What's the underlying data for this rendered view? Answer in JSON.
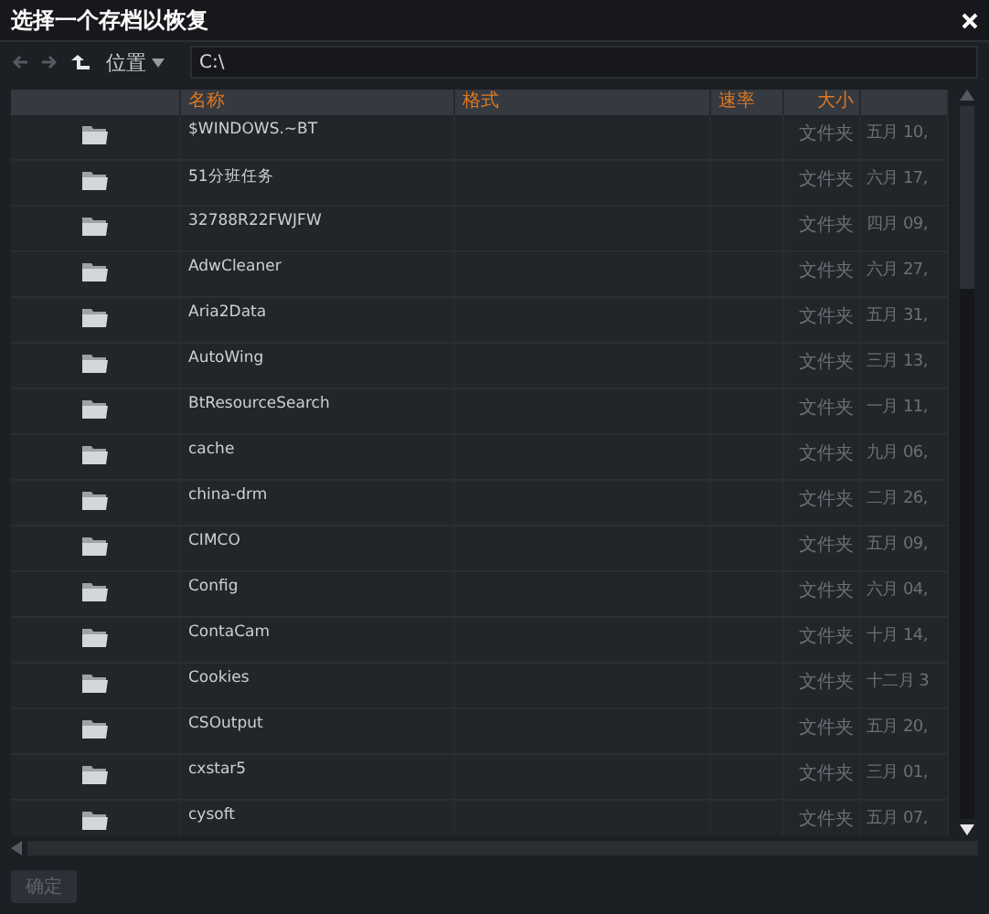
{
  "window": {
    "title": "选择一个存档以恢复"
  },
  "toolbar": {
    "back_disabled": true,
    "forward_disabled": true,
    "location_label": "位置",
    "path": "C:\\"
  },
  "table": {
    "columns": [
      "名称",
      "格式",
      "速率",
      "大小"
    ],
    "rows": [
      {
        "name": "$WINDOWS.~BT",
        "size": "文件夹",
        "date": "五月 10,"
      },
      {
        "name": "51分班任务",
        "size": "文件夹",
        "date": "六月 17,"
      },
      {
        "name": "32788R22FWJFW",
        "size": "文件夹",
        "date": "四月 09,"
      },
      {
        "name": "AdwCleaner",
        "size": "文件夹",
        "date": "六月 27,"
      },
      {
        "name": "Aria2Data",
        "size": "文件夹",
        "date": "五月 31,"
      },
      {
        "name": "AutoWing",
        "size": "文件夹",
        "date": "三月 13,"
      },
      {
        "name": "BtResourceSearch",
        "size": "文件夹",
        "date": "一月 11,"
      },
      {
        "name": "cache",
        "size": "文件夹",
        "date": "九月 06,"
      },
      {
        "name": "china-drm",
        "size": "文件夹",
        "date": "二月 26,"
      },
      {
        "name": "CIMCO",
        "size": "文件夹",
        "date": "五月 09,"
      },
      {
        "name": "Config",
        "size": "文件夹",
        "date": "六月 04,"
      },
      {
        "name": "ContaCam",
        "size": "文件夹",
        "date": "十月 14,"
      },
      {
        "name": "Cookies",
        "size": "文件夹",
        "date": "十二月 3"
      },
      {
        "name": "CSOutput",
        "size": "文件夹",
        "date": "五月 20,"
      },
      {
        "name": "cxstar5",
        "size": "文件夹",
        "date": "三月 01,"
      },
      {
        "name": "cysoft",
        "size": "文件夹",
        "date": "五月 07,"
      }
    ]
  },
  "footer": {
    "button": {
      "label": "确定",
      "disabled": true
    }
  }
}
